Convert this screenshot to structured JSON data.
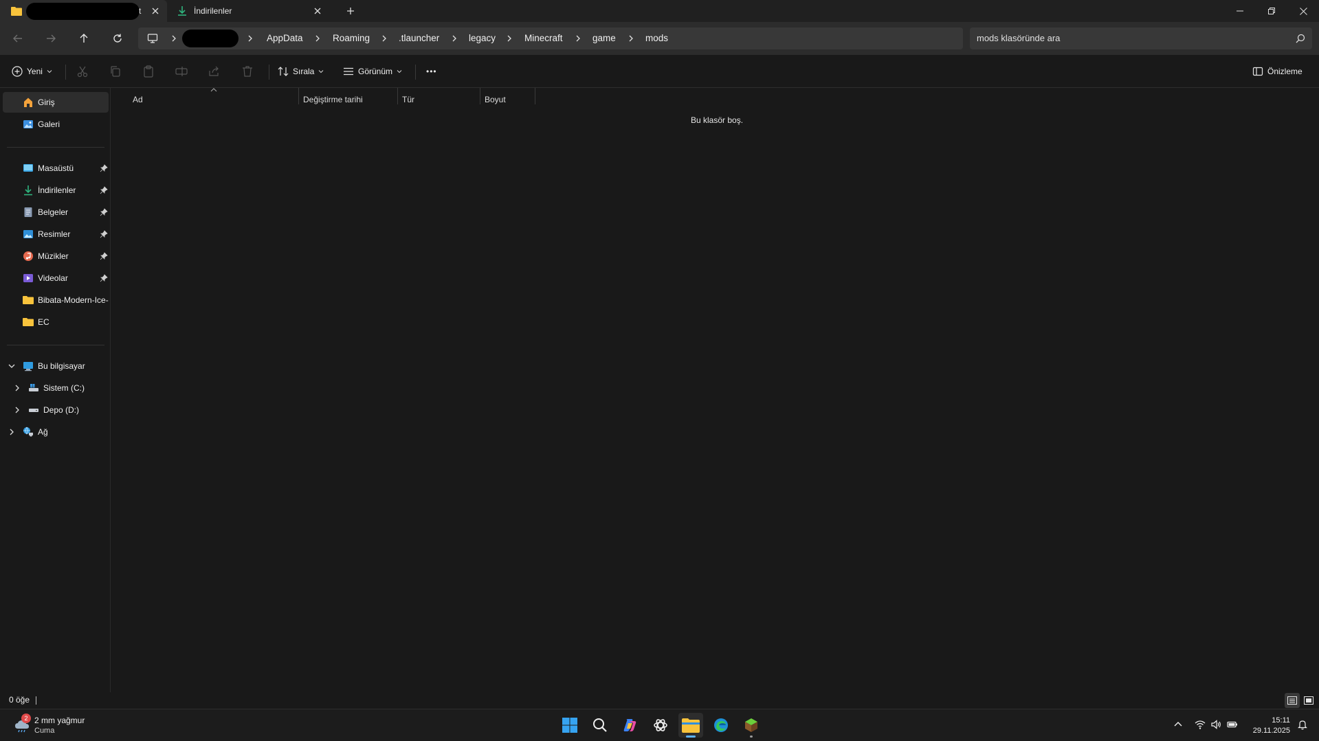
{
  "tabs": [
    {
      "label": "t",
      "redacted": true
    },
    {
      "label": "İndirilenler"
    }
  ],
  "window_controls": {
    "minimize": "minimize",
    "maximize": "restore",
    "close": "close"
  },
  "address": {
    "crumbs": [
      "AppData",
      "Roaming",
      ".tlauncher",
      "legacy",
      "Minecraft",
      "game",
      "mods"
    ],
    "redacted_user": true
  },
  "search": {
    "placeholder": "mods klasöründe ara"
  },
  "commands": {
    "new": "Yeni",
    "sort": "Sırala",
    "view": "Görünüm",
    "more": "•••",
    "preview": "Önizleme"
  },
  "sidebar": {
    "top": [
      {
        "label": "Giriş",
        "icon": "home-icon",
        "selected": true
      },
      {
        "label": "Galeri",
        "icon": "gallery-icon"
      }
    ],
    "pinned": [
      {
        "label": "Masaüstü",
        "icon": "desktop-icon",
        "pinned": true
      },
      {
        "label": "İndirilenler",
        "icon": "download-icon",
        "pinned": true
      },
      {
        "label": "Belgeler",
        "icon": "documents-icon",
        "pinned": true
      },
      {
        "label": "Resimler",
        "icon": "pictures-icon",
        "pinned": true
      },
      {
        "label": "Müzikler",
        "icon": "music-icon",
        "pinned": true
      },
      {
        "label": "Videolar",
        "icon": "videos-icon",
        "pinned": true
      },
      {
        "label": "Bibata-Modern-Ice-",
        "icon": "folder-icon"
      },
      {
        "label": "EC",
        "icon": "folder-icon"
      }
    ],
    "tree": [
      {
        "label": "Bu bilgisayar",
        "icon": "computer-icon",
        "expanded": true
      },
      {
        "label": "Sistem (C:)",
        "icon": "system-drive-icon"
      },
      {
        "label": "Depo (D:)",
        "icon": "drive-icon"
      },
      {
        "label": "Ağ",
        "icon": "network-icon"
      }
    ]
  },
  "columns": [
    "Ad",
    "Değiştirme tarihi",
    "Tür",
    "Boyut"
  ],
  "empty_message": "Bu klasör boş.",
  "status": {
    "item_count": "0 öğe"
  },
  "taskbar": {
    "weather": {
      "line1": "2 mm yağmur",
      "line2": "Cuma",
      "badge": "2"
    },
    "time": "15:11",
    "date": "29.11.2025"
  },
  "colors": {
    "accent": "#0078d4",
    "folder": "#f8c33c",
    "background": "#191919"
  }
}
